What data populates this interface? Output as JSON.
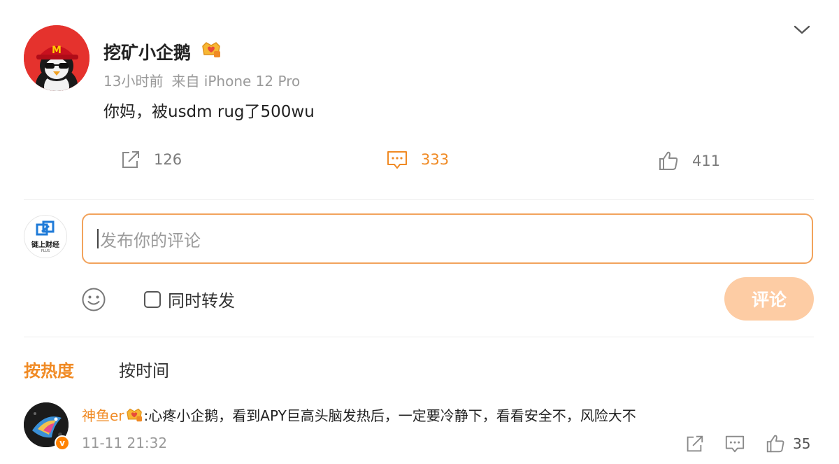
{
  "post": {
    "author": "挖矿小企鹅",
    "time": "13小时前",
    "source": "来自 iPhone 12 Pro",
    "text": "你妈，被usdm rug了500wu",
    "avatar_icon": "penguin-mcdonalds-avatar-icon",
    "badge_icon": "vip-crown-icon"
  },
  "actions": {
    "repost_count": "126",
    "comment_count": "333",
    "like_count": "411"
  },
  "composer": {
    "avatar_label": "链上财经",
    "avatar_sublabel": "PLUS",
    "placeholder": "发布你的评论",
    "repost_label": "同时转发",
    "submit_label": "评论"
  },
  "sort": {
    "hot": "按热度",
    "time": "按时间"
  },
  "comments": [
    {
      "author": "神鱼er",
      "text": ":心疼小企鹅，看到APY巨高头脑发热后，一定要冷静下，看看安全不，风险大不",
      "time": "11-11 21:32",
      "likes": "35",
      "verified_mark": "v"
    }
  ],
  "colors": {
    "accent": "#f08a24",
    "submit_disabled": "#fdcca4",
    "input_border": "#f2a35c",
    "avatar_red": "#e5322d"
  }
}
